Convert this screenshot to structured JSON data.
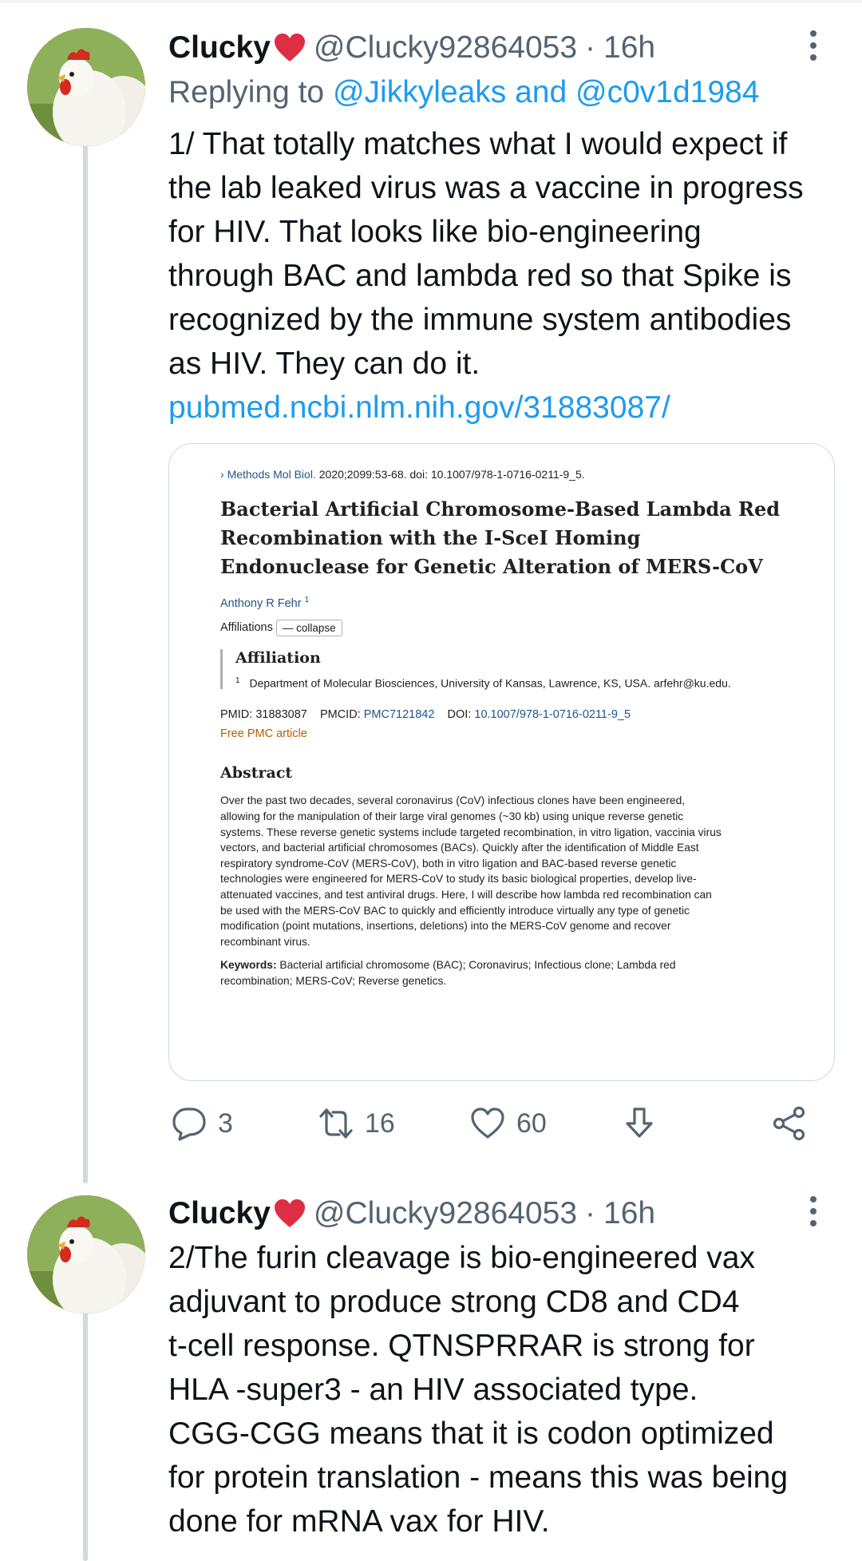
{
  "tweets": [
    {
      "display_name": "Clucky",
      "handle": "@Clucky92864053",
      "separator": "·",
      "time": "16h",
      "replying_prefix": "Replying to",
      "replying_users": "@Jikkyleaks and @c0v1d1984",
      "text_lines": [
        "1/ That totally matches what I would expect if",
        "the lab leaked virus was a vaccine in progress",
        "for HIV.  That looks like bio-engineering",
        "through BAC and lambda red so that Spike is",
        "recognized by the immune system antibodies",
        "as HIV.  They can do it."
      ],
      "link": "pubmed.ncbi.nlm.nih.gov/31883087/",
      "actions": {
        "replies": "3",
        "retweets": "16",
        "likes": "60"
      }
    },
    {
      "display_name": "Clucky",
      "handle": "@Clucky92864053",
      "separator": "·",
      "time": "16h",
      "text_lines": [
        "2/The furin cleavage is bio-engineered vax",
        "adjuvant to produce strong CD8 and CD4",
        "t-cell response.  QTNSPRRAR is strong for",
        "HLA -super3 - an HIV associated type.",
        "CGG-CGG means that it is codon optimized",
        "for protein translation - means this was being",
        "done for mRNA vax for HIV."
      ]
    }
  ],
  "article": {
    "journal_prefix": "›",
    "journal": "Methods Mol Biol.",
    "citation": "2020;2099:53-68. doi: 10.1007/978-1-0716-0211-9_5.",
    "title_lines": [
      "Bacterial Artificial Chromosome-Based Lambda Red",
      "Recombination with the I-SceI Homing",
      "Endonuclease for Genetic Alteration of MERS-CoV"
    ],
    "author": "Anthony R Fehr",
    "author_sup": "1",
    "affiliations_label": "Affiliations",
    "collapse_label": "— collapse",
    "affiliation_heading": "Affiliation",
    "affiliation_sup": "1",
    "affiliation_text": "Department of Molecular Biosciences, University of Kansas, Lawrence, KS, USA. arfehr@ku.edu.",
    "pmid_label": "PMID:",
    "pmid": "31883087",
    "pmcid_label": "PMCID:",
    "pmcid": "PMC7121842",
    "doi_label": "DOI:",
    "doi": "10.1007/978-1-0716-0211-9_5",
    "free_pmc": "Free PMC article",
    "abstract_heading": "Abstract",
    "abstract_lines": [
      "Over the past two decades, several coronavirus (CoV) infectious clones have been engineered,",
      "allowing for the manipulation of their large viral genomes (~30 kb) using unique reverse genetic",
      "systems. These reverse genetic systems include targeted recombination, in vitro ligation, vaccinia virus",
      "vectors, and bacterial artificial chromosomes (BACs). Quickly after the identification of Middle East",
      "respiratory syndrome-CoV (MERS-CoV), both in vitro ligation and BAC-based reverse genetic",
      "technologies were engineered for MERS-CoV to study its basic biological properties, develop live-",
      "attenuated vaccines, and test antiviral drugs. Here, I will describe how lambda red recombination can",
      "be used with the MERS-CoV BAC to quickly and efficiently introduce virtually any type of genetic",
      "modification (point mutations, insertions, deletions) into the MERS-CoV genome and recover",
      "recombinant virus."
    ],
    "keywords_label": "Keywords:",
    "keywords_lines": [
      "Bacterial artificial chromosome (BAC); Coronavirus; Infectious clone; Lambda red",
      "recombination; MERS-CoV; Reverse genetics."
    ]
  },
  "icons": {
    "heart_emoji": "red-heart-emoji",
    "more": "three-dots-vertical-icon",
    "reply": "speech-bubble-icon",
    "retweet": "retweet-arrows-icon",
    "like": "heart-outline-icon",
    "bookmark": "download-arrow-icon",
    "share": "share-nodes-icon"
  },
  "colors": {
    "link_blue": "#1d9bf0",
    "muted_gray": "#536471",
    "thread_line": "#cfd9de",
    "heart_red": "#dd2e44"
  }
}
